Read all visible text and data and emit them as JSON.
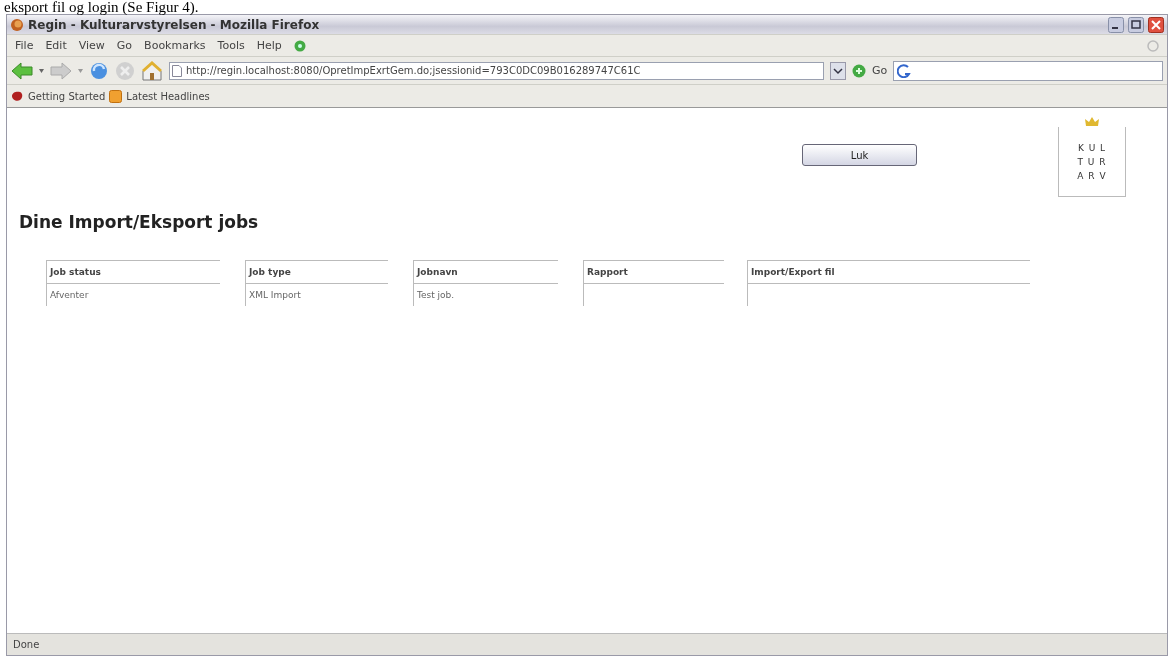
{
  "document_text": "eksport fil og login (Se Figur 4).",
  "window": {
    "title": "Regin - Kulturarvstyrelsen - Mozilla Firefox"
  },
  "menu": [
    "File",
    "Edit",
    "View",
    "Go",
    "Bookmarks",
    "Tools",
    "Help"
  ],
  "address": {
    "url": "http://regin.localhost:8080/OpretImpExrtGem.do;jsessionid=793C0DC09B016289747C61C"
  },
  "go_button": "Go",
  "bookmarks": [
    "Getting Started",
    "Latest Headlines"
  ],
  "page": {
    "close_button": "Luk",
    "logo_lines": [
      "K U L",
      "T U R",
      "A R V"
    ],
    "heading": "Dine Import/Eksport jobs",
    "table": {
      "columns": [
        "Job status",
        "Job type",
        "Jobnavn",
        "Rapport",
        "Import/Export fil"
      ],
      "rows": [
        {
          "cells": [
            "Afventer",
            "XML Import",
            "Test job."
          ]
        }
      ]
    }
  },
  "status_bar": "Done"
}
